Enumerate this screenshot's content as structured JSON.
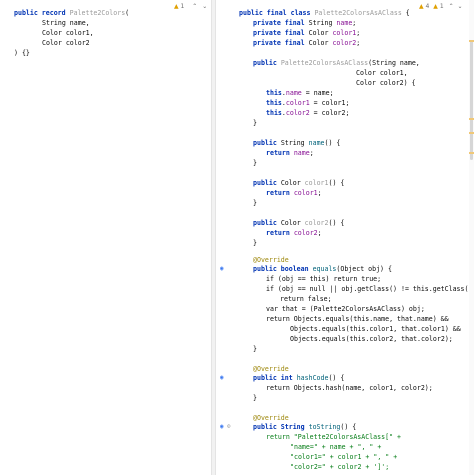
{
  "left_editor": {
    "status": {
      "warnings": "1"
    },
    "line1": {
      "kw": "public record",
      "name": "Palette2Colors"
    },
    "line2": "String name,",
    "line3": "Color color1,",
    "line4": "Color color2",
    "line5": ") {}"
  },
  "right_editor": {
    "status": {
      "warnings": "4",
      "weak": "1"
    },
    "class_kw": "public final class",
    "class_name": "Palette2ColorsAsAClass",
    "brace_open": "{",
    "brace_close": "}",
    "pf": "private final",
    "String": "String",
    "Color": "Color",
    "name": "name",
    "color1": "color1",
    "color2": "color2",
    "public": "public",
    "return": "return",
    "this": "this",
    "override": "@Override",
    "ctor_params": {
      "p1": "String name,",
      "p2": "Color color1,",
      "p3": "Color color2) {"
    },
    "equals": {
      "sig": "public boolean",
      "name": "equals",
      "params": "(Object obj) {",
      "if1": "if (obj == this) return true;",
      "if2a": "if (obj == null || obj.getClass() != this.getClass())",
      "ret_false": "return false;",
      "var_that": "var that = (Palette2ColorsAsAClass) obj;",
      "r1": "return Objects.equals(this.name, that.name) &&",
      "r2": "Objects.equals(this.color1, that.color1) &&",
      "r3": "Objects.equals(this.color2, that.color2);"
    },
    "hash": {
      "sig": "public int",
      "name": "hashCode",
      "params": "() {",
      "body": "return Objects.hash(name, color1, color2);"
    },
    "tostr": {
      "sig": "public String",
      "name": "toString",
      "params": "() {",
      "l1": "return \"Palette2ColorsAsAClass[\" +",
      "l2": "\"name=\" + name + \", \" +",
      "l3": "\"color1=\" + color1 + \", \" +",
      "l4": "\"color2=\" + color2 + ']';"
    }
  },
  "icons": {
    "warning": "warning-triangle-icon",
    "chevron_up": "chevron-up-icon",
    "chevron_down": "chevron-down-icon",
    "override": "override-gutter-icon"
  }
}
